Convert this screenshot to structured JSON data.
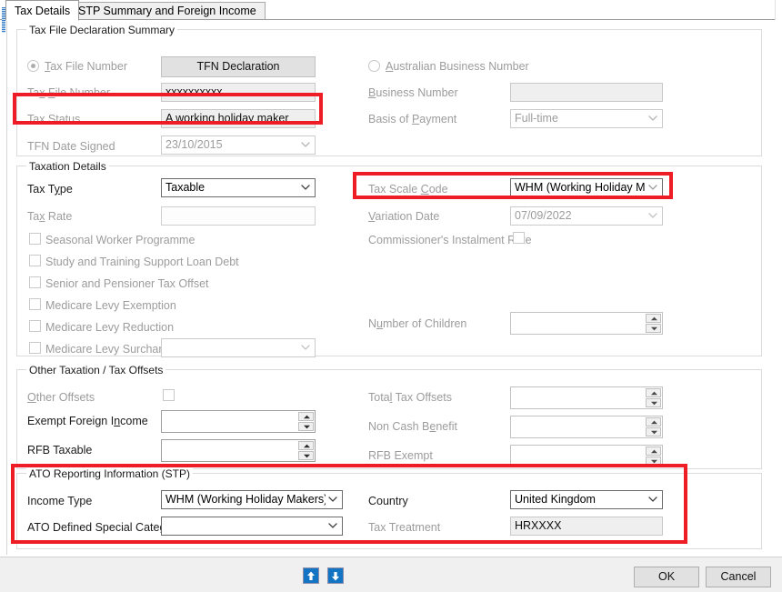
{
  "window": {
    "tabs": [
      {
        "label": "Tax Details",
        "active": true
      },
      {
        "label": "STP Summary and Foreign Income",
        "active": false
      }
    ]
  },
  "groups": {
    "tfn_summary": {
      "legend": "Tax File Declaration Summary",
      "radio_tfn_label": "Tax File Number",
      "radio_abn_label": "Australian Business Number",
      "tfn_declaration_button": "TFN Declaration",
      "tax_file_number_label": "Tax File Number",
      "tax_file_number_value": "xxxxxxxxxx",
      "tax_status_label": "Tax Status",
      "tax_status_value": "A working holiday maker",
      "tfn_date_signed_label": "TFN Date Signed",
      "tfn_date_signed_value": "23/10/2015",
      "business_number_label": "Business Number",
      "business_number_value": "",
      "basis_of_payment_label": "Basis of Payment",
      "basis_of_payment_value": "Full-time"
    },
    "taxation_details": {
      "legend": "Taxation Details",
      "tax_type_label": "Tax Type",
      "tax_type_value": "Taxable",
      "tax_rate_label": "Tax Rate",
      "tax_rate_value": "",
      "seasonal_worker_label": "Seasonal Worker Programme",
      "study_loan_label": "Study and Training Support Loan Debt",
      "senior_pensioner_label": "Senior and Pensioner Tax Offset",
      "medicare_exemption_label": "Medicare Levy Exemption",
      "medicare_reduction_label": "Medicare Levy Reduction",
      "medicare_surcharge_label": "Medicare Levy Surcharge",
      "medicare_surcharge_value": "",
      "tax_scale_code_label": "Tax Scale Code",
      "tax_scale_code_value": "WHM (Working Holiday Maker)",
      "variation_date_label": "Variation Date",
      "variation_date_value": "07/09/2022",
      "commissioners_rate_label": "Commissioner's Instalment Rate",
      "number_of_children_label": "Number of Children",
      "number_of_children_value": ""
    },
    "other_taxation": {
      "legend": "Other Taxation / Tax Offsets",
      "other_offsets_label": "Other Offsets",
      "exempt_foreign_income_label": "Exempt Foreign Income",
      "exempt_foreign_income_value": "",
      "rfb_taxable_label": "RFB Taxable",
      "rfb_taxable_value": "",
      "total_tax_offsets_label": "Total Tax Offsets",
      "total_tax_offsets_value": "",
      "non_cash_benefit_label": "Non Cash Benefit",
      "non_cash_benefit_value": "",
      "rfb_exempt_label": "RFB Exempt",
      "rfb_exempt_value": ""
    },
    "ato_reporting": {
      "legend": "ATO Reporting Information (STP)",
      "income_type_label": "Income Type",
      "income_type_value": "WHM (Working Holiday Makers)",
      "ato_special_category_label": "ATO Defined Special Category",
      "ato_special_category_value": "",
      "country_label": "Country",
      "country_value": "United Kingdom",
      "tax_treatment_label": "Tax Treatment",
      "tax_treatment_value": "HRXXXX"
    }
  },
  "footer": {
    "ok_label": "OK",
    "cancel_label": "Cancel"
  },
  "annotations": {
    "highlight_color": "#ee1c25",
    "boxes": [
      "tax-status-row",
      "tax-scale-code-row",
      "ato-reporting-section"
    ]
  }
}
